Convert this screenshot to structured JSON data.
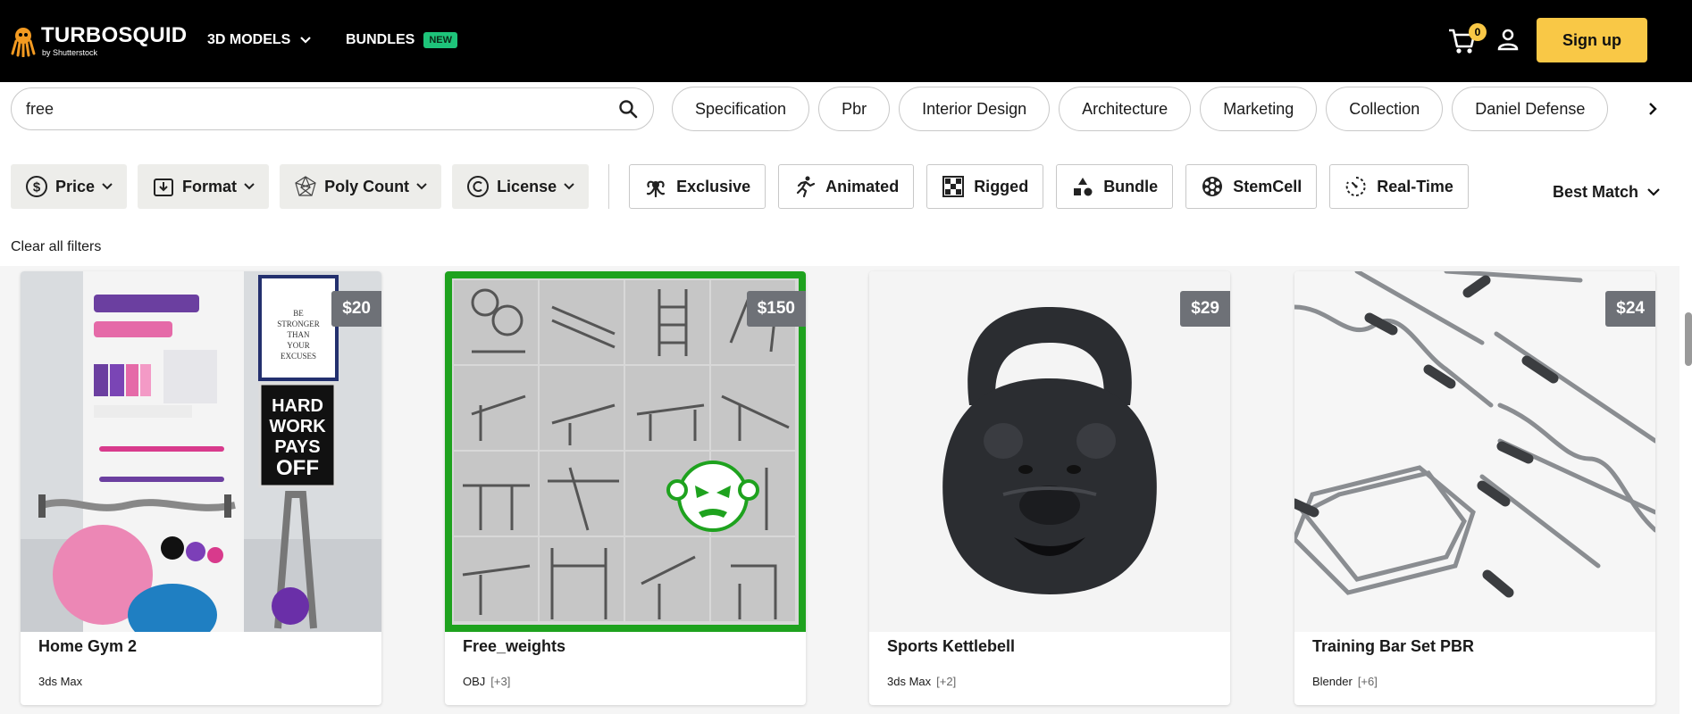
{
  "header": {
    "logo_main": "TURBOSQUID",
    "logo_sub": "by Shutterstock",
    "nav_3d_models": "3D MODELS",
    "nav_bundles": "BUNDLES",
    "badge_new": "NEW",
    "cart_count": "0",
    "signup": "Sign up",
    "accent_color": "#f9c846"
  },
  "search": {
    "value": "free",
    "icon": "search-icon"
  },
  "tags": [
    "Specification",
    "Pbr",
    "Interior Design",
    "Architecture",
    "Marketing",
    "Collection",
    "Daniel Defense"
  ],
  "filters": {
    "dropdowns": [
      "Price",
      "Format",
      "Poly Count",
      "License"
    ],
    "toggles": [
      "Exclusive",
      "Animated",
      "Rigged",
      "Bundle",
      "StemCell",
      "Real-Time"
    ]
  },
  "sort": {
    "label": "Best Match"
  },
  "clear_filters": "Clear all filters",
  "results": [
    {
      "title": "Home Gym 2",
      "price": "$20",
      "format": "3ds Max",
      "extra": ""
    },
    {
      "title": "Free_weights",
      "price": "$150",
      "format": "OBJ",
      "extra": "[+3]"
    },
    {
      "title": "Sports Kettlebell",
      "price": "$29",
      "format": "3ds Max",
      "extra": "[+2]"
    },
    {
      "title": "Training Bar Set PBR",
      "price": "$24",
      "format": "Blender",
      "extra": "[+6]"
    }
  ],
  "poster_text": {
    "motivation": "BE STRONGER THAN YOUR EXCUSES",
    "hard_work": [
      "HARD",
      "WORK",
      "PAYS",
      "OFF"
    ]
  }
}
